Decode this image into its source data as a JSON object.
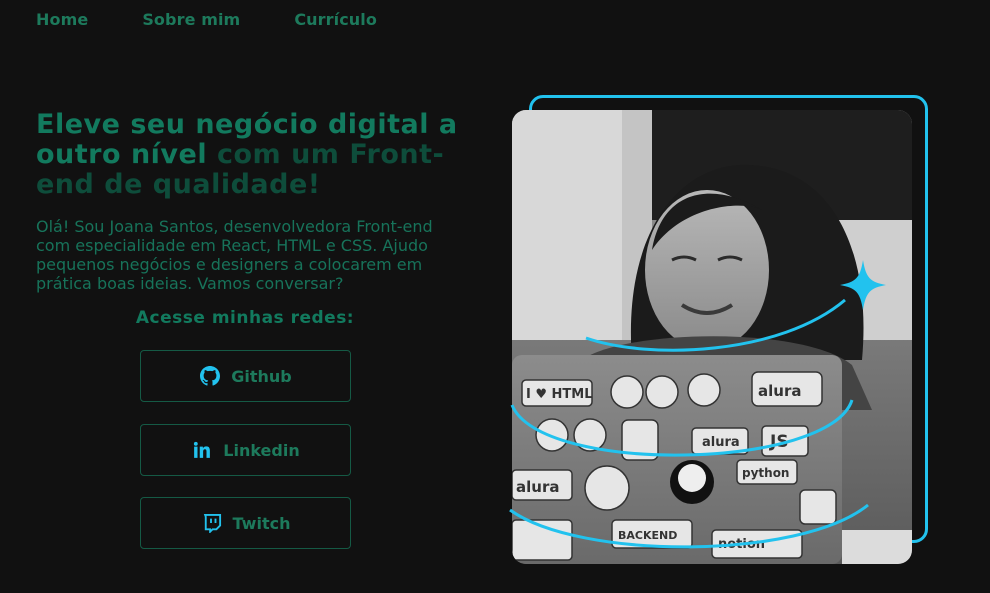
{
  "nav": {
    "home": "Home",
    "about": "Sobre mim",
    "cv": "Currículo"
  },
  "hero": {
    "headline_a": "Eleve seu negócio digital a outro nível",
    "headline_b": "com um Front-end de qualidade!",
    "intro": "Olá! Sou Joana Santos, desenvolvedora Front-end com especialidade em React, HTML e CSS. Ajudo pequenos negócios e designers a colocarem em prática boas ideias. Vamos conversar?"
  },
  "networks": {
    "title": "Acesse minhas redes:",
    "github": "Github",
    "linkedin": "Linkedin",
    "twitch": "Twitch"
  },
  "laptop_stickers": {
    "sticker_1": "alura",
    "sticker_2": "JS",
    "sticker_3": "python",
    "sticker_4": "notion",
    "sticker_5": "I ♥ HTML",
    "sticker_6": "BACKEND"
  },
  "colors": {
    "background": "#111111",
    "accent_green": "#127a5e",
    "dark_green": "#0e4d3b",
    "accent_cyan": "#22c2ee"
  }
}
